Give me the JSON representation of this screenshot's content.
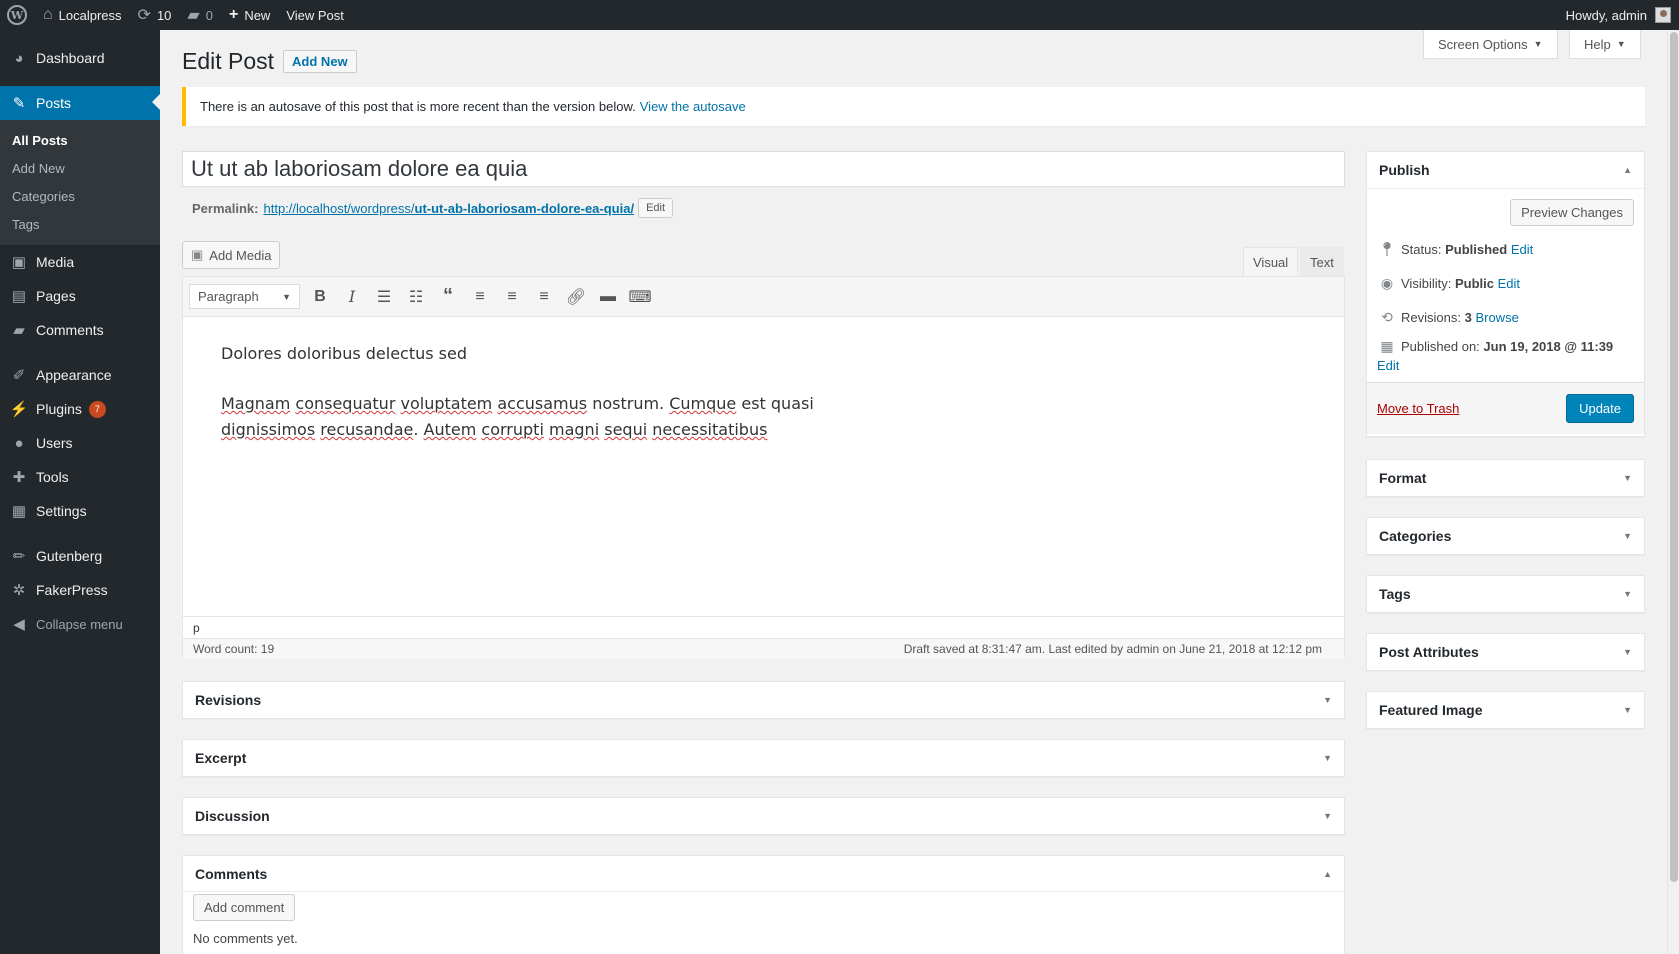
{
  "adminbar": {
    "site": "Localpress",
    "updates": "10",
    "comments": "0",
    "new": "New",
    "view_post": "View Post",
    "howdy": "Howdy, admin"
  },
  "sidebar": {
    "items": [
      {
        "label": "Dashboard",
        "icon": "dashboard-icon"
      },
      {
        "label": "Posts",
        "icon": "pin-icon"
      },
      {
        "label": "Media",
        "icon": "media-icon"
      },
      {
        "label": "Pages",
        "icon": "pages-icon"
      },
      {
        "label": "Comments",
        "icon": "comments-icon"
      },
      {
        "label": "Appearance",
        "icon": "brush-icon"
      },
      {
        "label": "Plugins",
        "icon": "plugins-icon",
        "badge": "7"
      },
      {
        "label": "Users",
        "icon": "users-icon"
      },
      {
        "label": "Tools",
        "icon": "tools-icon"
      },
      {
        "label": "Settings",
        "icon": "settings-icon"
      },
      {
        "label": "Gutenberg",
        "icon": "pencil-icon"
      },
      {
        "label": "FakerPress",
        "icon": "fakerpress-icon"
      }
    ],
    "submenu": [
      "All Posts",
      "Add New",
      "Categories",
      "Tags"
    ],
    "collapse": "Collapse menu"
  },
  "top_tabs": {
    "screen_options": "Screen Options",
    "help": "Help"
  },
  "page": {
    "title": "Edit Post",
    "add_new": "Add New"
  },
  "notice": {
    "text": "There is an autosave of this post that is more recent than the version below.",
    "link": "View the autosave"
  },
  "post": {
    "title": "Ut ut ab laboriosam dolore ea quia",
    "permalink_label": "Permalink:",
    "permalink_base": "http://localhost/wordpress/",
    "permalink_slug": "ut-ut-ab-laboriosam-dolore-ea-quia/",
    "permalink_edit": "Edit"
  },
  "editor": {
    "add_media": "Add Media",
    "tab_visual": "Visual",
    "tab_text": "Text",
    "format": "Paragraph",
    "para1": "Dolores doloribus delectus sed",
    "para2_line1": "est quasi",
    "path": "p",
    "word_count": "Word count: 19",
    "draft_saved": "Draft saved at 8:31:47 am. Last edited by admin on June 21, 2018 at 12:12 pm"
  },
  "publish": {
    "title": "Publish",
    "preview": "Preview Changes",
    "status_label": "Status:",
    "status_value": "Published",
    "visibility_label": "Visibility:",
    "visibility_value": "Public",
    "revisions_label": "Revisions:",
    "revisions_value": "3",
    "browse": "Browse",
    "published_label": "Published on:",
    "published_value": "Jun 19, 2018 @ 11:39",
    "edit": "Edit",
    "trash": "Move to Trash",
    "update": "Update"
  },
  "side_boxes": [
    "Format",
    "Categories",
    "Tags",
    "Post Attributes",
    "Featured Image"
  ],
  "main_boxes": [
    "Revisions",
    "Excerpt",
    "Discussion"
  ],
  "comments_box": {
    "title": "Comments",
    "add_comment": "Add comment",
    "no_comments": "No comments yet."
  }
}
